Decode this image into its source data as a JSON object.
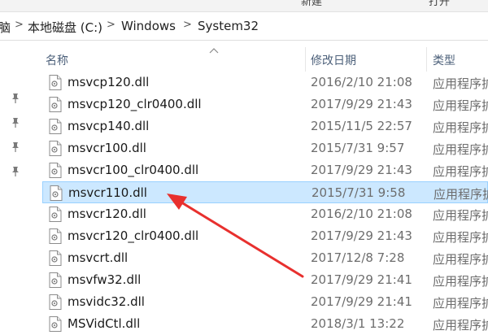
{
  "ribbon": {
    "new_label": "新建",
    "open_label": "打开"
  },
  "address": {
    "root_fragment": "脑",
    "segments": [
      "本地磁盘 (C:)",
      "Windows",
      "System32"
    ]
  },
  "columns": {
    "name": "名称",
    "date": "修改日期",
    "type": "类型"
  },
  "files": [
    {
      "name": "msvcp120.dll",
      "date": "2016/2/10 21:08",
      "type": "应用程序扩"
    },
    {
      "name": "msvcp120_clr0400.dll",
      "date": "2017/9/29 21:43",
      "type": "应用程序扩"
    },
    {
      "name": "msvcp140.dll",
      "date": "2015/11/5 22:57",
      "type": "应用程序扩"
    },
    {
      "name": "msvcr100.dll",
      "date": "2015/7/31 9:57",
      "type": "应用程序扩"
    },
    {
      "name": "msvcr100_clr0400.dll",
      "date": "2017/9/29 21:43",
      "type": "应用程序扩"
    },
    {
      "name": "msvcr110.dll",
      "date": "2015/7/31 9:58",
      "type": "应用程序扩",
      "selected": true
    },
    {
      "name": "msvcr120.dll",
      "date": "2016/2/10 21:08",
      "type": "应用程序扩"
    },
    {
      "name": "msvcr120_clr0400.dll",
      "date": "2017/9/29 21:43",
      "type": "应用程序扩"
    },
    {
      "name": "msvcrt.dll",
      "date": "2017/12/8 7:28",
      "type": "应用程序扩"
    },
    {
      "name": "msvfw32.dll",
      "date": "2017/9/29 21:41",
      "type": "应用程序扩"
    },
    {
      "name": "msvidc32.dll",
      "date": "2017/9/29 21:41",
      "type": "应用程序扩"
    },
    {
      "name": "MSVidCtl.dll",
      "date": "2018/3/1 13:22",
      "type": "应用程序扩"
    }
  ],
  "colors": {
    "selection": "#cce8ff",
    "selection_border": "#99d1ff",
    "arrow": "#e8302e"
  },
  "icons": [
    "pin-icon",
    "dll-file-icon",
    "sort-up-icon",
    "chevron-right-icon"
  ]
}
